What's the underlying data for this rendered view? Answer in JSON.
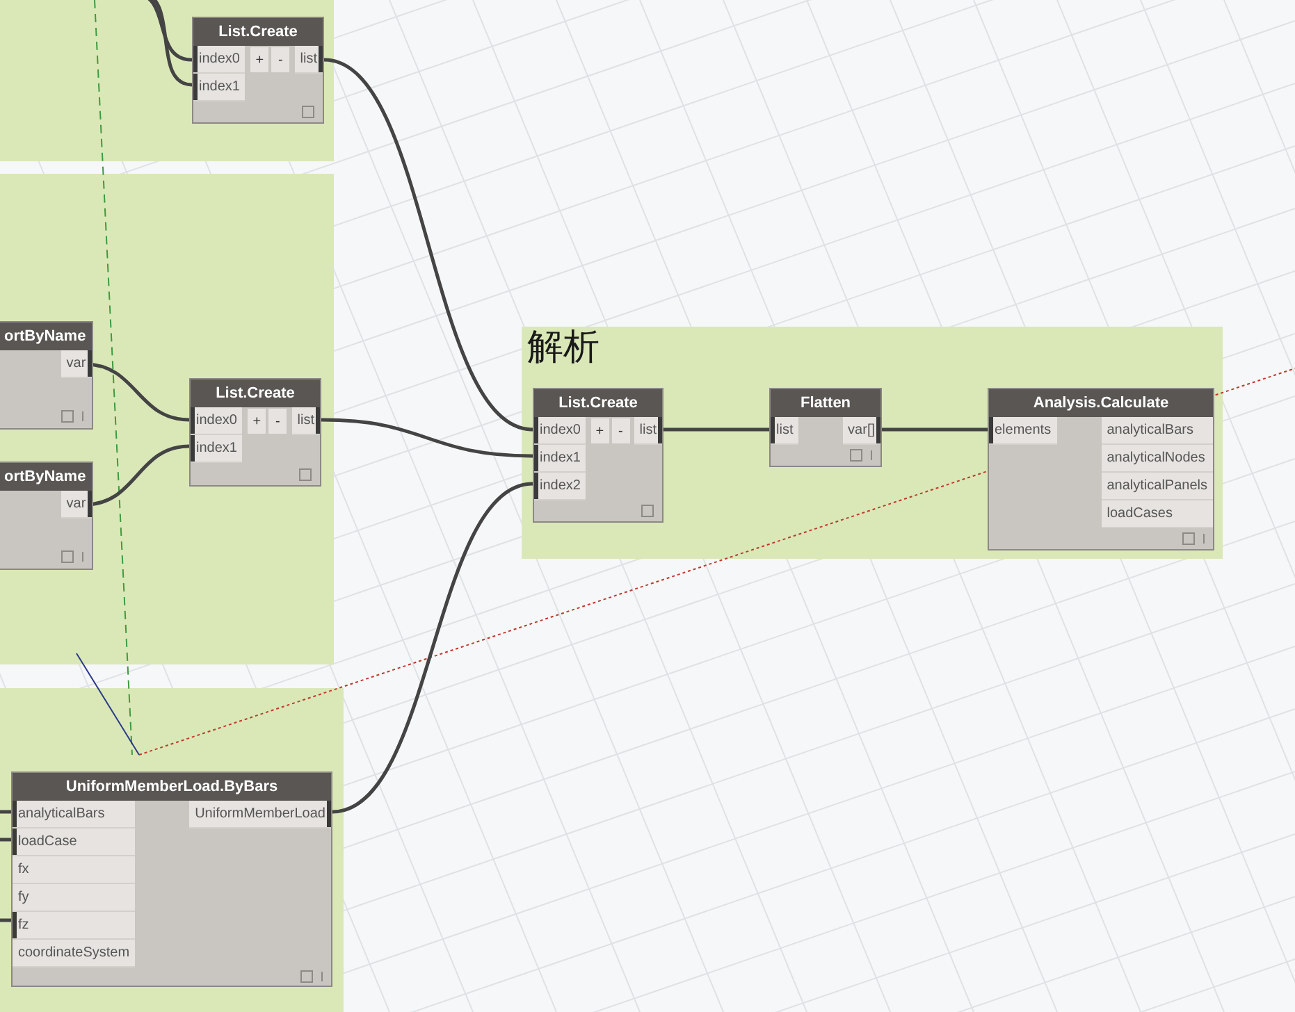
{
  "groups": [
    {
      "kind": "group"
    },
    {
      "kind": "group"
    },
    {
      "kind": "group",
      "title": "解析"
    },
    {
      "kind": "group"
    }
  ],
  "nodes": [
    {
      "title": "List.Create",
      "inputs": [
        {
          "label": "index0",
          "connected": true
        },
        {
          "label": "index1",
          "connected": true
        }
      ],
      "buttons": [
        "+",
        "-"
      ],
      "outputs": [
        {
          "label": "list",
          "connected": true
        }
      ],
      "lacing": false
    },
    {
      "title": "ortByName",
      "outputs": [
        {
          "label": "var",
          "connected": true
        }
      ],
      "lacing": true
    },
    {
      "title": "ortByName",
      "outputs": [
        {
          "label": "var",
          "connected": true
        }
      ],
      "lacing": true
    },
    {
      "title": "List.Create",
      "inputs": [
        {
          "label": "index0",
          "connected": true
        },
        {
          "label": "index1",
          "connected": true
        }
      ],
      "buttons": [
        "+",
        "-"
      ],
      "outputs": [
        {
          "label": "list",
          "connected": true
        }
      ],
      "lacing": false
    },
    {
      "title": "List.Create",
      "inputs": [
        {
          "label": "index0",
          "connected": true
        },
        {
          "label": "index1",
          "connected": true
        },
        {
          "label": "index2",
          "connected": true
        }
      ],
      "buttons": [
        "+",
        "-"
      ],
      "outputs": [
        {
          "label": "list",
          "connected": true
        }
      ],
      "lacing": false
    },
    {
      "title": "Flatten",
      "inputs": [
        {
          "label": "list",
          "connected": true
        }
      ],
      "outputs": [
        {
          "label": "var[]",
          "connected": true
        }
      ],
      "lacing": true
    },
    {
      "title": "Analysis.Calculate",
      "inputs": [
        {
          "label": "elements",
          "connected": true
        }
      ],
      "outputs": [
        {
          "label": "analyticalBars",
          "connected": false
        },
        {
          "label": "analyticalNodes",
          "connected": false
        },
        {
          "label": "analyticalPanels",
          "connected": false
        },
        {
          "label": "loadCases",
          "connected": false
        }
      ],
      "lacing": true
    },
    {
      "title": "UniformMemberLoad.ByBars",
      "inputs": [
        {
          "label": "analyticalBars",
          "connected": true
        },
        {
          "label": "loadCase",
          "connected": true
        },
        {
          "label": "fx",
          "connected": false
        },
        {
          "label": "fy",
          "connected": false
        },
        {
          "label": "fz",
          "connected": true
        },
        {
          "label": "coordinateSystem",
          "connected": false
        }
      ],
      "outputs": [
        {
          "label": "UniformMemberLoad",
          "connected": true
        }
      ],
      "lacing": true
    }
  ]
}
